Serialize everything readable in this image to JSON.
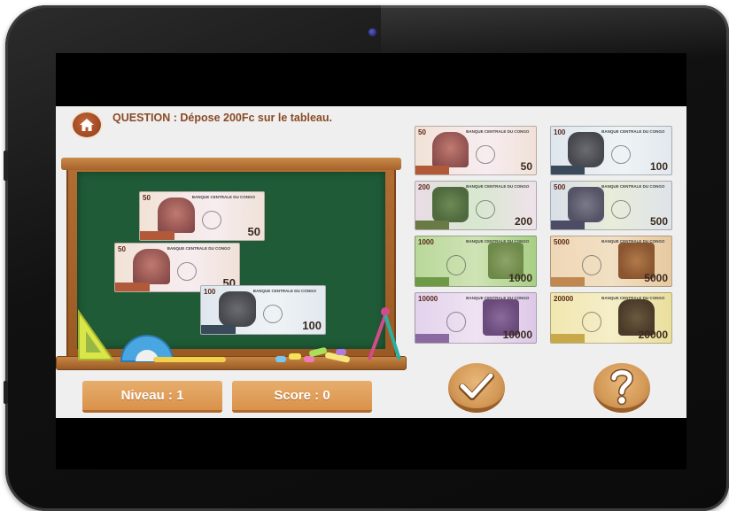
{
  "question": {
    "text": "QUESTION : Dépose 200Fc sur le tableau."
  },
  "board_notes": [
    {
      "value": "50",
      "type": "n50"
    },
    {
      "value": "50",
      "type": "n50"
    },
    {
      "value": "100",
      "type": "n100"
    }
  ],
  "palette_notes": [
    {
      "value": "50",
      "type": "n50"
    },
    {
      "value": "100",
      "type": "n100"
    },
    {
      "value": "200",
      "type": "n200"
    },
    {
      "value": "500",
      "type": "n500"
    },
    {
      "value": "1000",
      "type": "n1000"
    },
    {
      "value": "5000",
      "type": "n5000"
    },
    {
      "value": "10000",
      "type": "n10000"
    },
    {
      "value": "20000",
      "type": "n20000"
    }
  ],
  "bank_name": "BANQUE CENTRALE DU CONGO",
  "status": {
    "level_label": "Niveau : 1",
    "score_label": "Score : 0"
  },
  "icons": {
    "home": "home-icon",
    "validate": "checkmark-icon",
    "help": "question-mark-icon"
  },
  "colors": {
    "accent": "#d9924c",
    "board": "#1f5b37",
    "question_text": "#8a4a24"
  }
}
